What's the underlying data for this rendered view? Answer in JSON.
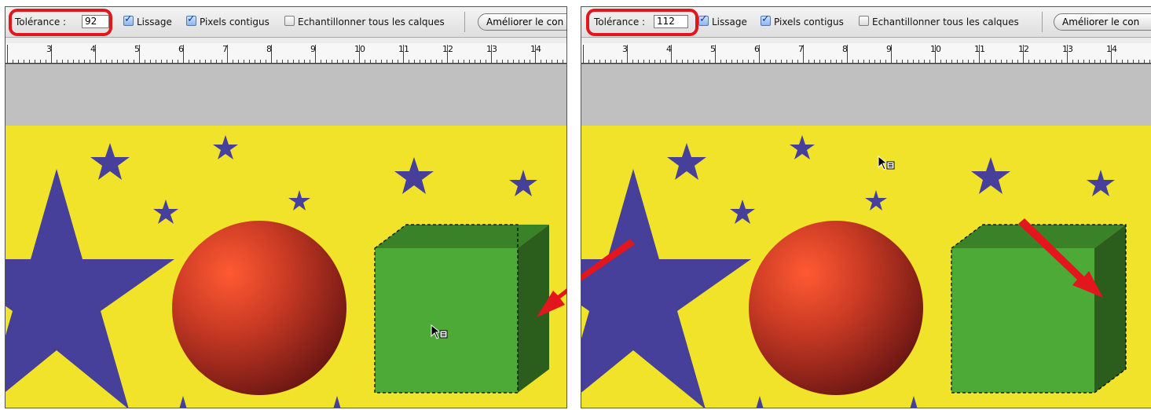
{
  "panels": [
    {
      "id": "left",
      "options_bar": {
        "tolerance_label": "Tolérance :",
        "tolerance_value": "92",
        "checkboxes": [
          {
            "label": "Lissage",
            "checked": true
          },
          {
            "label": "Pixels contigus",
            "checked": true
          },
          {
            "label": "Echantillonner tous les calques",
            "checked": false
          }
        ],
        "refine_button": "Améliorer le con"
      },
      "ruler": {
        "labels": [
          "3",
          "4",
          "5",
          "6",
          "7",
          "8",
          "9",
          "10",
          "11",
          "12",
          "13",
          "14"
        ]
      }
    },
    {
      "id": "right",
      "options_bar": {
        "tolerance_label": "Tolérance :",
        "tolerance_value": "112",
        "checkboxes": [
          {
            "label": "Lissage",
            "checked": true
          },
          {
            "label": "Pixels contigus",
            "checked": true
          },
          {
            "label": "Echantillonner tous les calques",
            "checked": false
          }
        ],
        "refine_button": "Améliorer le con"
      },
      "ruler": {
        "labels": [
          "3",
          "4",
          "5",
          "6",
          "7",
          "8",
          "9",
          "10",
          "11",
          "12",
          "13",
          "14"
        ]
      }
    }
  ],
  "colors": {
    "highlight": "#e3151d",
    "canvas_yellow": "#f1e32a",
    "star_purple": "#47409a",
    "cube_front": "#4eaa36",
    "cube_top": "#3a8228",
    "cube_side": "#2b5e1d",
    "sphere_light": "#ff5a32",
    "sphere_dark": "#7a1a16",
    "arrow_red": "#e3151d"
  },
  "icons": [
    "magic-wand-cursor-icon",
    "checkbox-checked-icon",
    "annotation-arrow-icon"
  ]
}
